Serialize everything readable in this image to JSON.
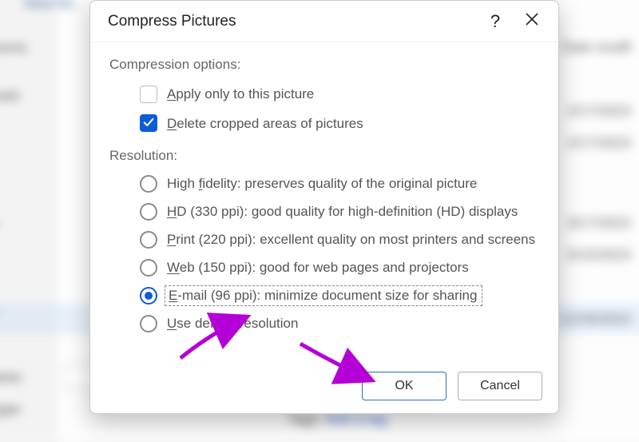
{
  "dialog": {
    "title": "Compress Pictures",
    "help_symbol": "?",
    "section_compression": "Compression options:",
    "apply_only": "Apply only to this picture",
    "delete_cropped": "Delete cropped areas of pictures",
    "section_resolution": "Resolution:",
    "radios": {
      "high_fidelity": "High fidelity: preserves quality of the original picture",
      "hd": "HD (330 ppi): good quality for high-definition (HD) displays",
      "print": "Print (220 ppi): excellent quality on most printers and screens",
      "web": "Web (150 ppi): good for web pages and projectors",
      "email": "E-mail (96 ppi): minimize document size for sharing",
      "default": "Use default resolution"
    },
    "buttons": {
      "ok": "OK",
      "cancel": "Cancel"
    }
  },
  "background": {
    "new_folder": "New fol...",
    "date_modif": "Date modif",
    "tags_label": "Tags:",
    "add_tag": "Add a tag",
    "dates": {
      "a": "2/17/2023",
      "b": "2/17/2023",
      "c": "3/17/2022",
      "d": "5/15/2023",
      "e": "12/29/2022"
    },
    "side": {
      "ments": "ments",
      "oads": "oads",
      "s": "s",
      "o": "o"
    },
    "labels": {
      "name": "ame:",
      "type": "type:"
    }
  }
}
